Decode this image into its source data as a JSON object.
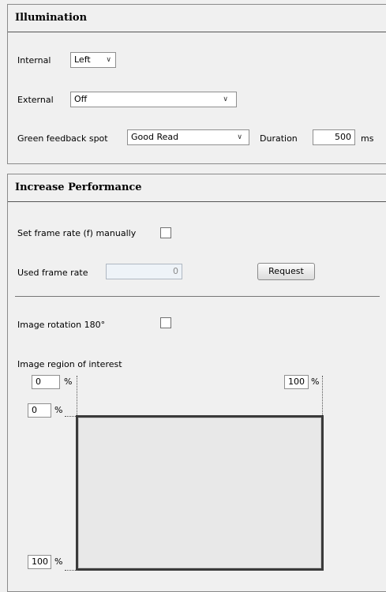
{
  "illumination": {
    "title": "Illumination",
    "internal_label": "Internal",
    "internal_value": "Left",
    "external_label": "External",
    "external_value": "Off",
    "green_label": "Green feedback spot",
    "green_value": "Good Read",
    "duration_label": "Duration",
    "duration_value": "500",
    "duration_unit": "ms"
  },
  "performance": {
    "title": "Increase Performance",
    "frame_rate_manual_label": "Set frame rate (f) manually",
    "frame_rate_manual_checked": false,
    "used_frame_rate_label": "Used frame rate",
    "used_frame_rate_value": "0",
    "request_label": "Request",
    "rotation_label": "Image rotation 180°",
    "rotation_checked": false,
    "roi_label": "Image region of interest",
    "roi_left": "0",
    "roi_right": "100",
    "roi_top": "0",
    "roi_bottom": "100",
    "percent": "%"
  }
}
